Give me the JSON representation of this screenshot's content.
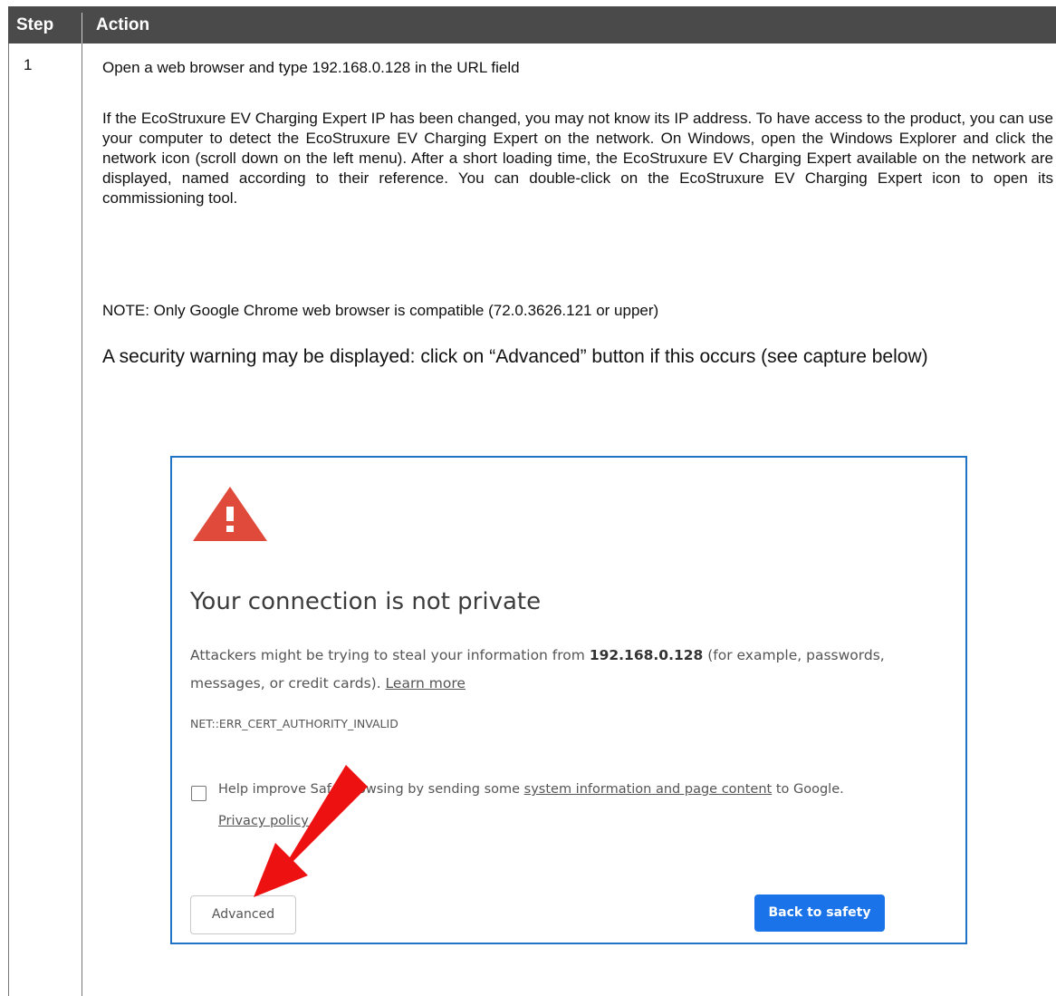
{
  "table": {
    "header": {
      "step": "Step",
      "action": "Action"
    },
    "row": {
      "step": "1",
      "open_instruction": "Open a web browser and type 192.168.0.128 in the URL field",
      "body_text": "If the EcoStruxure EV Charging Expert IP has been changed, you may not know its IP address. To have access to the product, you can use your computer to detect the EcoStruxure EV Charging Expert on the network. On Windows, open the Windows Explorer and click the network icon (scroll down on the left menu). After a short loading time, the EcoStruxure EV Charging Expert available on the network are displayed, named according to their reference. You can double-click on the EcoStruxure EV Charging Expert icon to open its commissioning tool.",
      "note": "NOTE: Only Google Chrome web browser is compatible (72.0.3626.121 or upper)",
      "warning": "A security warning may be displayed: click on “Advanced” button if this occurs (see capture below)"
    }
  },
  "capture": {
    "icon": "warning-triangle-icon",
    "title": "Your connection is not private",
    "text_before": "Attackers might be trying to steal your information from ",
    "host": "192.168.0.128",
    "text_after": " (for example, passwords, messages, or credit cards). ",
    "learn_more": "Learn more",
    "error_code": "NET::ERR_CERT_AUTHORITY_INVALID",
    "help_before": "Help improve Safe Browsing by sending some ",
    "help_link": "system information and page content",
    "help_after": " to Google.",
    "privacy_link": "Privacy policy",
    "advanced_button": "Advanced",
    "back_button": "Back to safety",
    "colors": {
      "border": "#1f74c7",
      "primary_button": "#1a73e8",
      "warning": "#e04a3a",
      "arrow": "#ee1111"
    }
  }
}
